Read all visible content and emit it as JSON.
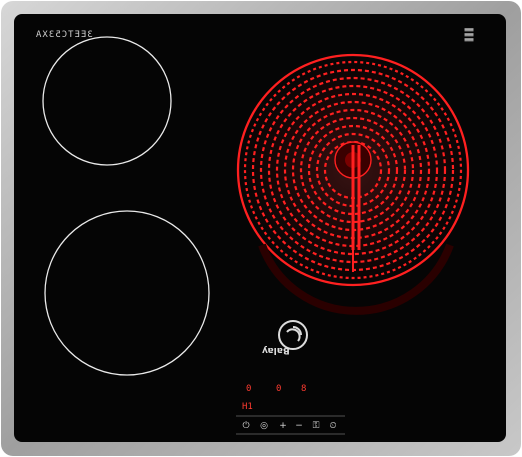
{
  "product": {
    "model_code": "3EETC53XA",
    "brand": "Balay"
  },
  "glass": {
    "color": "#050505",
    "frame_color": "#b7b7b7",
    "zone_outline_color": "#e6e6e6",
    "heating_color": "#ff1a1a"
  },
  "zones": [
    {
      "name": "top-left",
      "state": "off",
      "visual": "outline"
    },
    {
      "name": "bottom-left",
      "state": "off",
      "visual": "outline"
    },
    {
      "name": "right-dual",
      "state": "on",
      "visual": "glowing coil"
    }
  ],
  "display": {
    "rear_zone_indicator": "0",
    "front_zone_indicator": "0",
    "left_power_level": "H1",
    "right_digit": "8"
  },
  "controls": [
    {
      "name": "power",
      "symbol": "⏻"
    },
    {
      "name": "child-lock",
      "symbol": "◎"
    },
    {
      "name": "plus",
      "symbol": "+"
    },
    {
      "name": "minus",
      "symbol": "−"
    },
    {
      "name": "key",
      "symbol": "⚿"
    },
    {
      "name": "timer",
      "symbol": "⏲"
    }
  ]
}
